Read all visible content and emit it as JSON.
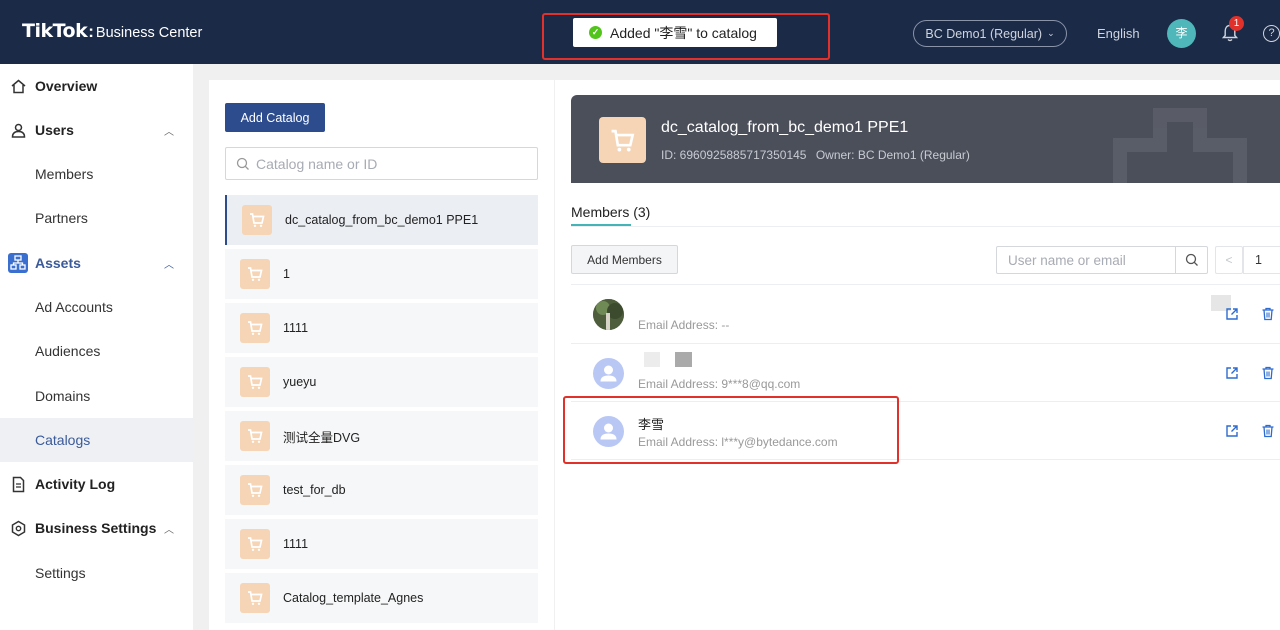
{
  "header": {
    "logo_brand": "TikTok",
    "logo_colon": ":",
    "logo_product": "Business Center",
    "toast_message": "Added \"李雪\" to catalog",
    "bc_selector": "BC Demo1 (Regular)",
    "language": "English",
    "avatar_initial": "李",
    "notification_count": "1",
    "help": "?"
  },
  "sidebar": {
    "overview": "Overview",
    "users": "Users",
    "members": "Members",
    "partners": "Partners",
    "assets": "Assets",
    "ad_accounts": "Ad Accounts",
    "audiences": "Audiences",
    "domains": "Domains",
    "catalogs": "Catalogs",
    "activity_log": "Activity Log",
    "business_settings": "Business Settings",
    "settings": "Settings"
  },
  "catalog_list": {
    "add_button": "Add Catalog",
    "search_placeholder": "Catalog name or ID",
    "items": [
      "dc_catalog_from_bc_demo1 PPE1",
      "1",
      "1111",
      "yueyu",
      "测试全量DVG",
      "test_for_db",
      "1111",
      "Catalog_template_Agnes"
    ]
  },
  "detail": {
    "title": "dc_catalog_from_bc_demo1 PPE1",
    "id_text": "ID: 6960925885717350145",
    "owner_text": "Owner: BC Demo1 (Regular)",
    "members_tab": "Members (3)",
    "add_members_button": "Add Members",
    "user_search_placeholder": "User name or email",
    "pager_prev": "<",
    "pager_page": "1",
    "members": [
      {
        "name": "",
        "email": "Email Address: --"
      },
      {
        "name": "",
        "email": "Email Address: 9***8@qq.com"
      },
      {
        "name": "李雪",
        "email": "Email Address: l***y@bytedance.com"
      }
    ]
  },
  "colors": {
    "header_bg": "#1b2a47",
    "primary": "#2d4c8e",
    "accent_teal": "#45b4b6",
    "highlight_red": "#e0312b",
    "success_green": "#52c41a"
  }
}
